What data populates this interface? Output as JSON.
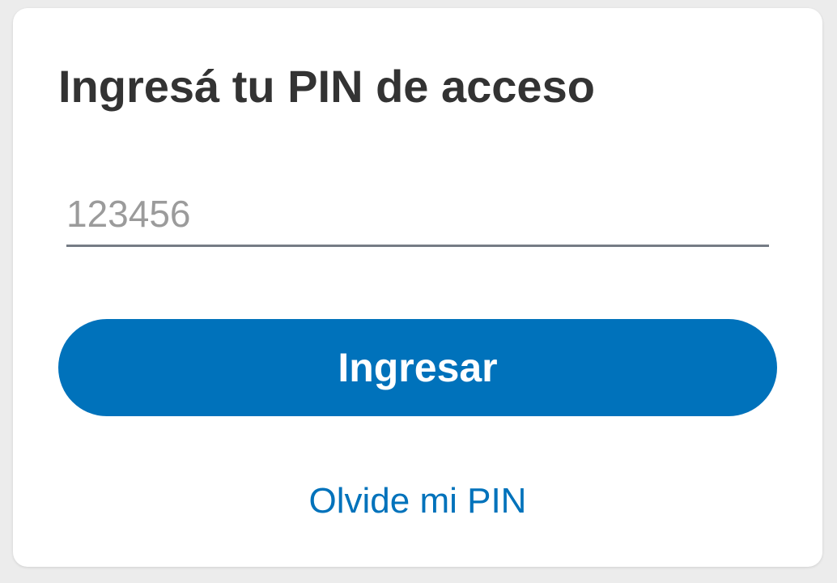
{
  "card": {
    "title": "Ingresá tu PIN de acceso"
  },
  "pin": {
    "value": "",
    "placeholder": "123456"
  },
  "submit": {
    "label": "Ingresar"
  },
  "forgot": {
    "label": "Olvide mi PIN"
  },
  "colors": {
    "background": "#ececec",
    "card": "#ffffff",
    "title": "#333333",
    "accent": "#0072bb",
    "button_text": "#ffffff",
    "input_underline": "#757c85",
    "placeholder": "#9b9b9b"
  }
}
